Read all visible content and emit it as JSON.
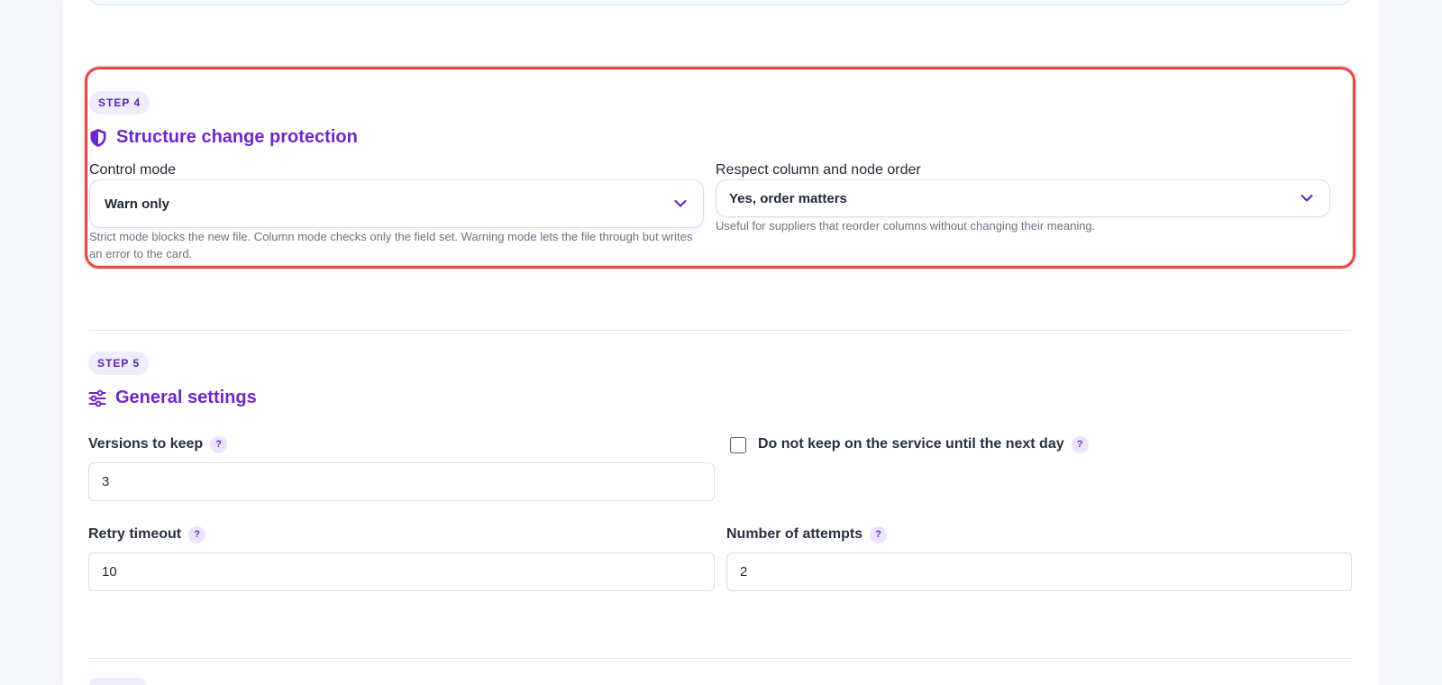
{
  "step4": {
    "badge": "STEP 4",
    "title": "Structure change protection",
    "title_icon": "shield-icon",
    "control_mode": {
      "label": "Control mode",
      "value": "Warn only",
      "hint": "Strict mode blocks the new file. Column mode checks only the field set. Warning mode lets the file through but writes an error to the card."
    },
    "order": {
      "label": "Respect column and node order",
      "value": "Yes, order matters",
      "hint": "Useful for suppliers that reorder columns without changing their meaning."
    }
  },
  "step5": {
    "badge": "STEP 5",
    "title": "General settings",
    "title_icon": "sliders-icon",
    "versions": {
      "label": "Versions to keep",
      "value": "3"
    },
    "no_keep": {
      "label": "Do not keep on the service until the next day",
      "checked": false
    },
    "retry_timeout": {
      "label": "Retry timeout",
      "value": "10"
    },
    "attempts": {
      "label": "Number of attempts",
      "value": "2"
    },
    "help_glyph": "?"
  },
  "colors": {
    "accent": "#6d28c9",
    "highlight_border": "#e5484d",
    "badge_bg": "#efedfb"
  }
}
